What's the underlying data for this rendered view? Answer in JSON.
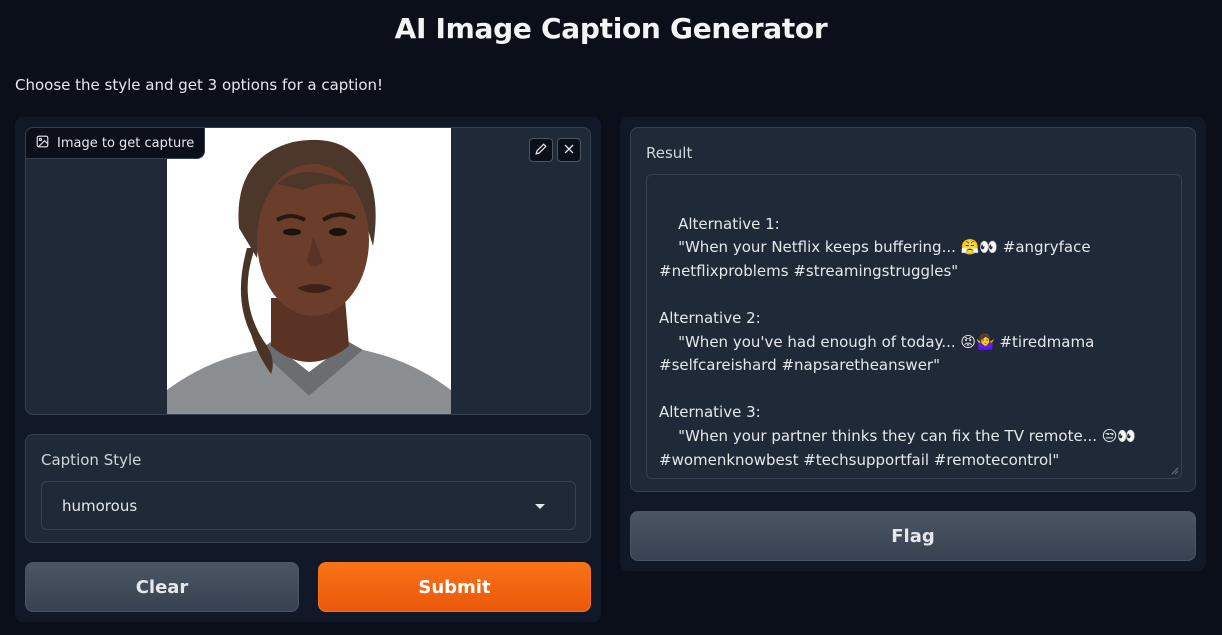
{
  "header": {
    "title": "AI Image Caption Generator",
    "description": "Choose the style and get 3 options for a caption!"
  },
  "image_input": {
    "label": "Image to get capture",
    "icon": "image-icon",
    "edit_icon": "pencil-icon",
    "close_icon": "close-icon"
  },
  "caption_style": {
    "label": "Caption Style",
    "selected": "humorous"
  },
  "buttons": {
    "clear": "Clear",
    "submit": "Submit",
    "flag": "Flag"
  },
  "result": {
    "label": "Result",
    "text": "\n    Alternative 1:\n    \"When your Netflix keeps buffering... 😤👀 #angryface #netflixproblems #streamingstruggles\"\n\nAlternative 2:\n    \"When you've had enough of today... 😡🤷‍♀️ #tiredmama #selfcareishard #napsaretheanswer\"\n\nAlternative 3:\n    \"When your partner thinks they can fix the TV remote... 😒👀 #womenknowbest #techsupportfail #remotecontrol\""
  },
  "colors": {
    "background": "#0b0f19",
    "panel": "#111827",
    "block": "#1f2937",
    "accent": "#f97316"
  }
}
